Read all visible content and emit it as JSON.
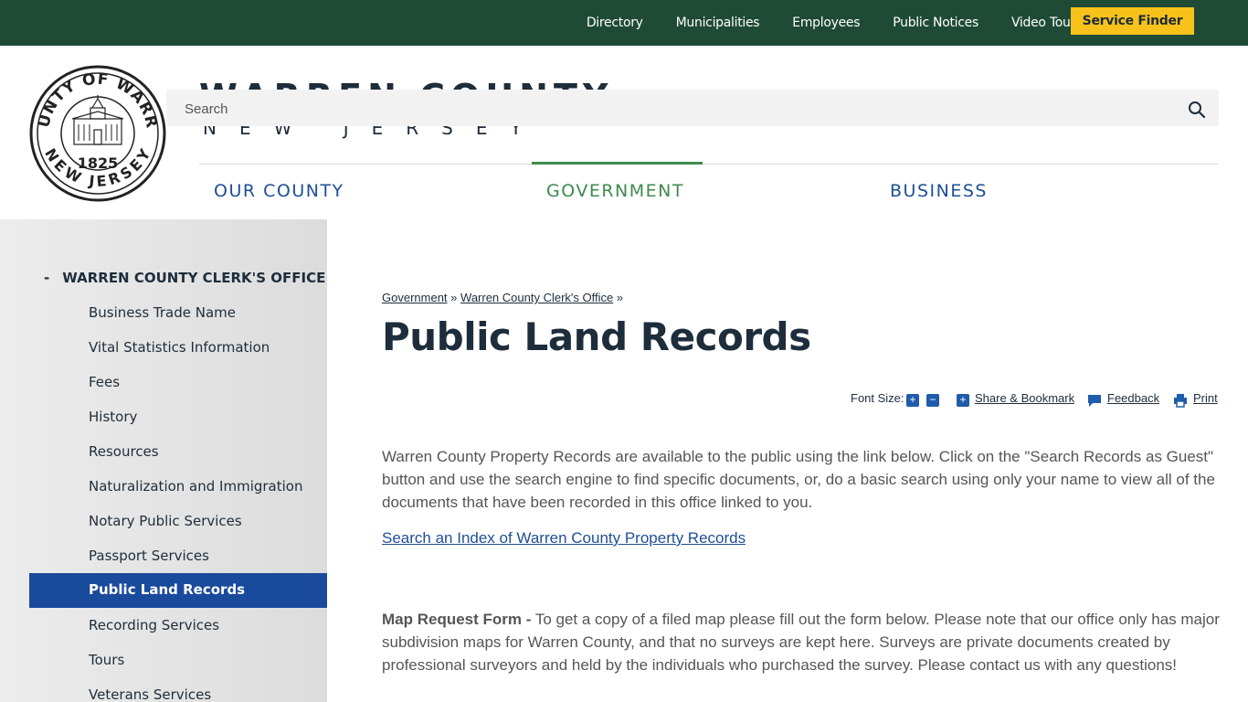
{
  "topbar": {
    "links": [
      "Directory",
      "Municipalities",
      "Employees",
      "Public Notices",
      "Video Tours"
    ],
    "service_finder": "Service Finder"
  },
  "brand": {
    "title": "WARREN COUNTY",
    "subtitle": "NEW JERSEY",
    "seal_top": "COUNTY OF WARREN",
    "seal_bottom": "NEW JERSEY",
    "seal_year": "1825"
  },
  "search": {
    "placeholder": "Search"
  },
  "mainnav": {
    "items": [
      "OUR COUNTY",
      "GOVERNMENT",
      "BUSINESS"
    ],
    "active": "GOVERNMENT"
  },
  "sidebar": {
    "heading_prefix": "-",
    "heading": "WARREN COUNTY CLERK'S OFFICE",
    "items": [
      "Business Trade Name",
      "Vital Statistics Information",
      "Fees",
      "History",
      "Resources",
      "Naturalization and Immigration",
      "Notary Public Services",
      "Passport Services",
      "Public Land Records",
      "Recording Services",
      "Tours",
      "Veterans Services"
    ],
    "active": "Public Land Records"
  },
  "breadcrumb": {
    "items": [
      "Government",
      "Warren County Clerk's Office"
    ],
    "sep": "»"
  },
  "page": {
    "title": "Public Land Records",
    "tools": {
      "font_size_label": "Font Size:",
      "plus": "+",
      "minus": "−",
      "share": "Share & Bookmark",
      "feedback": "Feedback",
      "print": "Print"
    },
    "intro": "Warren County Property Records are available to the public using the link below. Click on the \"Search Records as Guest\" button and use the search engine to find specific documents, or, do a basic search using only your name to view all of the documents that have been recorded in this office linked to you.",
    "records_link": "Search an Index of Warren County Property Records",
    "map_lead": "Map Request Form -",
    "map_text": " To get a copy of a filed map please fill out the form below. Please note that our office only has major subdivision maps for Warren County, and that no surveys are kept here. Surveys are private documents created by professional surveyors and held by the individuals who purchased the survey. Please contact us with any questions!"
  },
  "colors": {
    "topbar": "#1e4a36",
    "service_btn": "#f7c31a",
    "nav_blue": "#1f4e96",
    "nav_active": "#3e8a4f",
    "sidebar_active": "#1a4a9c"
  }
}
